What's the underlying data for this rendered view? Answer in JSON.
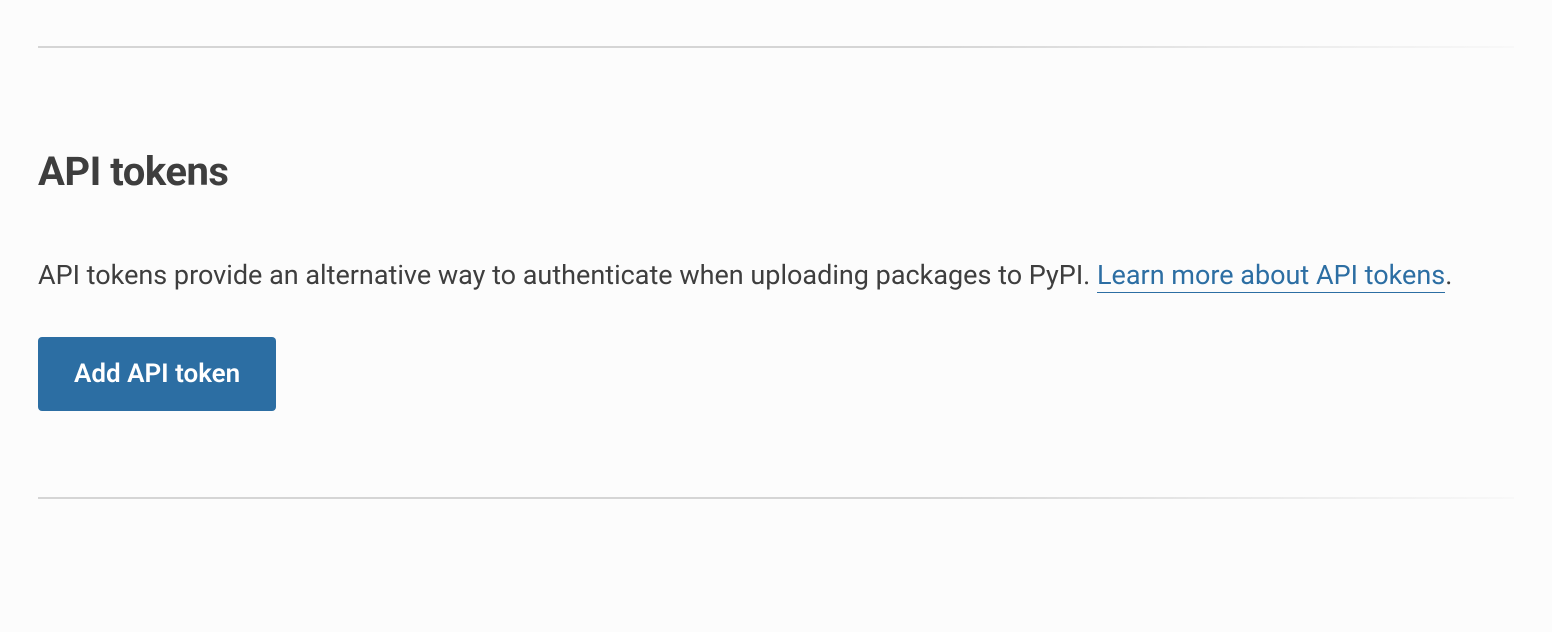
{
  "section": {
    "title": "API tokens",
    "description_text": "API tokens provide an alternative way to authenticate when uploading packages to PyPI. ",
    "learn_more_link": "Learn more about API tokens",
    "period": ".",
    "add_button_label": "Add API token"
  }
}
